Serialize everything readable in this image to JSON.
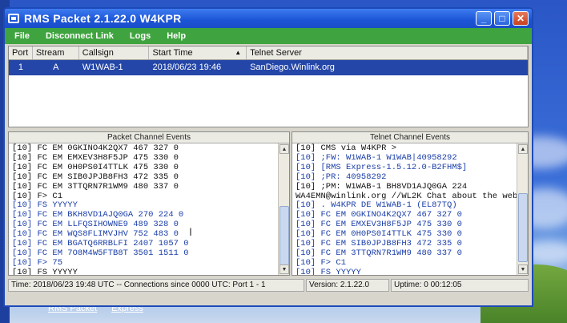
{
  "window": {
    "title": "RMS Packet 2.1.22.0 W4KPR",
    "buttons": {
      "minimize": "_",
      "maximize": "□",
      "close": "✕"
    }
  },
  "menu": [
    "File",
    "Disconnect Link",
    "Logs",
    "Help"
  ],
  "connections": {
    "columns": [
      "Port",
      "Stream",
      "Callsign",
      "Start Time",
      "Telnet Server"
    ],
    "rows": [
      {
        "port": "1",
        "stream": "A",
        "callsign": "W1WAB-1",
        "start_time": "2018/06/23 19:46",
        "telnet_server": "SanDiego.Winlink.org"
      }
    ]
  },
  "packet_panel": {
    "title": "Packet Channel Events",
    "lines": [
      {
        "text": "[10] FC EM 0GKINO4K2QX7 467 327 0",
        "color": "black"
      },
      {
        "text": "[10] FC EM EMXEV3H8F5JP 475 330 0",
        "color": "black"
      },
      {
        "text": "[10] FC EM 0H0PS0I4TTLK 475 330 0",
        "color": "black"
      },
      {
        "text": "[10] FC EM SIB0JPJB8FH3 472 335 0",
        "color": "black"
      },
      {
        "text": "[10] FC EM 3TTQRN7R1WM9 480 337 0",
        "color": "black"
      },
      {
        "text": "[10] F> C1",
        "color": "black"
      },
      {
        "text": "[10] FS YYYYY",
        "color": "blue"
      },
      {
        "text": "[10] FC EM BKH8VD1AJQ0GA 270 224 0",
        "color": "blue"
      },
      {
        "text": "[10] FC EM LLFQSIHOWNE9 489 328 0",
        "color": "blue"
      },
      {
        "text": "[10] FC EM WQS8FLIMVJHV 752 483 0",
        "color": "blue"
      },
      {
        "text": "[10] FC EM BGATQ6RRBLFI 2407 1057 0",
        "color": "blue"
      },
      {
        "text": "[10] FC EM 7O8M4W5FTB8T 3501 1511 0",
        "color": "blue"
      },
      {
        "text": "[10] F> 75",
        "color": "blue"
      },
      {
        "text": "[10] FS YYYYY",
        "color": "black"
      }
    ]
  },
  "telnet_panel": {
    "title": "Telnet Channel Events",
    "lines": [
      {
        "text": "[10] CMS via W4KPR >",
        "color": "black"
      },
      {
        "text": "[10] ;FW: W1WAB-1 W1WAB|40958292",
        "color": "blue"
      },
      {
        "text": "[10] [RMS Express-1.5.12.0-B2FHM$]",
        "color": "blue"
      },
      {
        "text": "[10] ;PR: 40958292",
        "color": "blue"
      },
      {
        "text": "[10] ;PM: W1WAB-1 BH8VD1AJQ0GA 224",
        "color": "black"
      },
      {
        "text": "WA4EMN@winlink.org //WL2K Chat about the website",
        "color": "black"
      },
      {
        "text": "[10] . W4KPR DE W1WAB-1 (EL87TQ)",
        "color": "blue"
      },
      {
        "text": "[10] FC EM 0GKINO4K2QX7 467 327 0",
        "color": "blue"
      },
      {
        "text": "[10] FC EM EMXEV3H8F5JP 475 330 0",
        "color": "blue"
      },
      {
        "text": "[10] FC EM 0H0PS0I4TTLK 475 330 0",
        "color": "blue"
      },
      {
        "text": "[10] FC EM SIB0JPJB8FH3 472 335 0",
        "color": "blue"
      },
      {
        "text": "[10] FC EM 3TTQRN7R1WM9 480 337 0",
        "color": "blue"
      },
      {
        "text": "[10] F> C1",
        "color": "blue"
      },
      {
        "text": "[10] FS YYYYY",
        "color": "blue"
      }
    ]
  },
  "status": {
    "time": "Time: 2018/06/23 19:48 UTC -- Connections since 0000 UTC: Port 1 - 1",
    "version": "Version: 2.1.22.0",
    "uptime": "Uptime: 0 00:12:05"
  },
  "taskbar": [
    "RMS Packet",
    "Express"
  ],
  "colors": {
    "text_black": "#111111",
    "text_blue": "#1a3ea8",
    "selected_row": "#2446a8",
    "menubar": "#3fa43f",
    "titlebar": "#1c54d6"
  }
}
